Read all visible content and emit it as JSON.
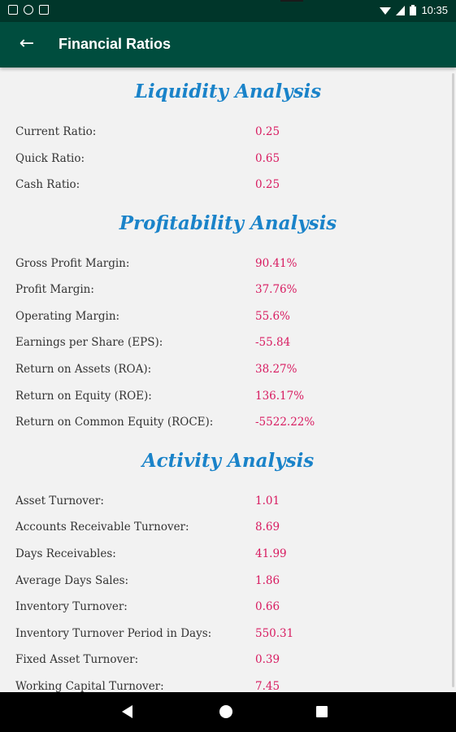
{
  "status_bar": {
    "time": "10:35"
  },
  "app_bar": {
    "back_icon": "←",
    "title": "Financial Ratios"
  },
  "sections": [
    {
      "title": "Liquidity Analysis",
      "rows": [
        {
          "label": "Current Ratio:",
          "value": "0.25"
        },
        {
          "label": "Quick Ratio:",
          "value": "0.65"
        },
        {
          "label": "Cash Ratio:",
          "value": "0.25"
        }
      ]
    },
    {
      "title": "Profitability Analysis",
      "rows": [
        {
          "label": "Gross Profit Margin:",
          "value": "90.41%"
        },
        {
          "label": "Profit Margin:",
          "value": "37.76%"
        },
        {
          "label": "Operating Margin:",
          "value": "55.6%"
        },
        {
          "label": "Earnings per Share (EPS):",
          "value": "-55.84"
        },
        {
          "label": "Return on Assets (ROA):",
          "value": "38.27%"
        },
        {
          "label": "Return on Equity (ROE):",
          "value": "136.17%"
        },
        {
          "label": "Return on Common Equity (ROCE):",
          "value": "-5522.22%"
        }
      ]
    },
    {
      "title": "Activity Analysis",
      "rows": [
        {
          "label": "Asset Turnover:",
          "value": "1.01"
        },
        {
          "label": "Accounts Receivable Turnover:",
          "value": "8.69"
        },
        {
          "label": "Days Receivables:",
          "value": "41.99"
        },
        {
          "label": "Average Days Sales:",
          "value": "1.86"
        },
        {
          "label": "Inventory Turnover:",
          "value": "0.66"
        },
        {
          "label": "Inventory Turnover Period in Days:",
          "value": "550.31"
        },
        {
          "label": "Fixed Asset Turnover:",
          "value": "0.39"
        },
        {
          "label": "Working Capital Turnover:",
          "value": "7.45"
        }
      ]
    }
  ],
  "colors": {
    "status_bar": "#00362a",
    "app_bar": "#004d3e",
    "section_title": "#1a83c9",
    "value_text": "#d81b60",
    "label_text": "#333333",
    "background": "#f2f2f2"
  },
  "icons": {
    "status_left": [
      "notification-icon",
      "sync-icon",
      "sd-card-icon"
    ],
    "status_right": [
      "wifi-icon",
      "signal-icon",
      "battery-icon"
    ],
    "nav": [
      "nav-back-icon",
      "nav-home-icon",
      "nav-recents-icon"
    ]
  }
}
